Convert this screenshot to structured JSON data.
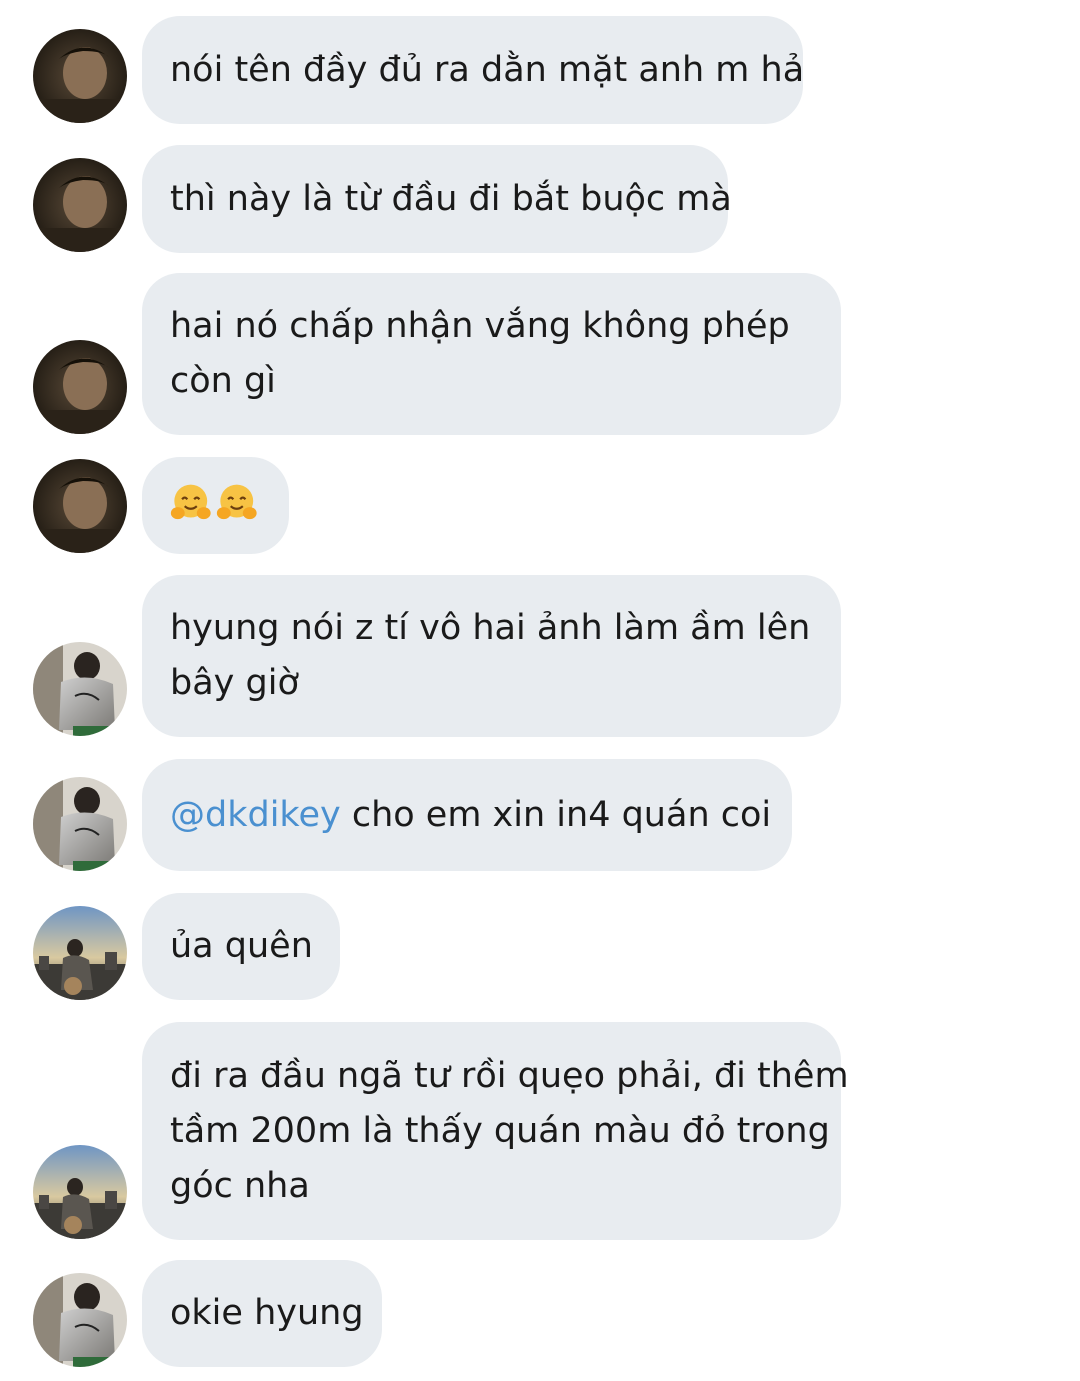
{
  "avatar_icons": {
    "a": "person-dark-portrait-avatar-icon",
    "b": "person-white-shirt-avatar-icon",
    "c": "person-rooftop-sunset-avatar-icon"
  },
  "messages": [
    {
      "sender_avatar": "a",
      "lines": [
        "nói tên đầy đủ ra dằn mặt anh m hả"
      ]
    },
    {
      "sender_avatar": "a",
      "lines": [
        "thì này là từ đầu đi bắt buộc mà"
      ]
    },
    {
      "sender_avatar": "a",
      "lines": [
        "hai nó chấp nhận vắng không phép",
        "còn gì"
      ]
    },
    {
      "sender_avatar": "a",
      "emojis": [
        "hugging-face-emoji",
        "hugging-face-emoji"
      ]
    },
    {
      "sender_avatar": "b",
      "lines": [
        "hyung nói z tí vô hai ảnh làm ầm lên",
        "bây giờ"
      ]
    },
    {
      "sender_avatar": "b",
      "mention": "@dkdikey",
      "text": " cho em xin in4 quán coi"
    },
    {
      "sender_avatar": "c",
      "lines": [
        "ủa quên"
      ]
    },
    {
      "sender_avatar": "c",
      "lines": [
        "đi ra đầu ngã tư rồi quẹo phải, đi thêm",
        "tầm 200m là thấy quán màu đỏ trong",
        "góc nha"
      ]
    },
    {
      "sender_avatar": "b",
      "lines": [
        "okie hyung"
      ]
    }
  ]
}
